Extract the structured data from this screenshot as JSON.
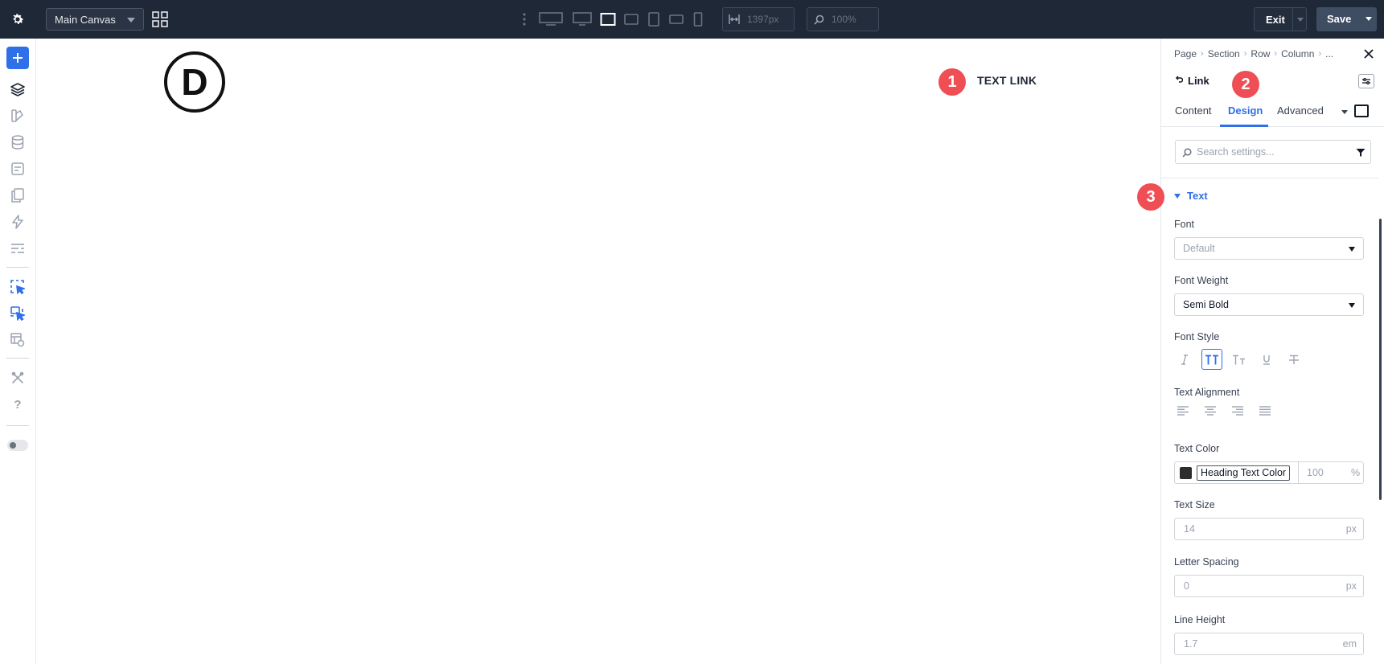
{
  "topbar": {
    "canvas_select": "Main Canvas",
    "width_value": "1397px",
    "zoom_value": "100%",
    "exit_label": "Exit",
    "save_label": "Save",
    "devices": [
      "desktop-wide",
      "desktop",
      "laptop",
      "tablet-landscape",
      "tablet",
      "phone-landscape",
      "phone"
    ],
    "active_device": "laptop"
  },
  "canvas": {
    "logo_letter": "D",
    "text_link": "TEXT LINK"
  },
  "badges": [
    "1",
    "2",
    "3"
  ],
  "panel": {
    "breadcrumbs": [
      "Page",
      "Section",
      "Row",
      "Column",
      "..."
    ],
    "module_name": "Link",
    "tabs": [
      "Content",
      "Design",
      "Advanced"
    ],
    "active_tab": "Design",
    "search_placeholder": "Search settings...",
    "group_title": "Text",
    "font": {
      "label": "Font",
      "value": "Default"
    },
    "font_weight": {
      "label": "Font Weight",
      "value": "Semi Bold"
    },
    "font_style": {
      "label": "Font Style",
      "active": "uppercase"
    },
    "text_alignment": {
      "label": "Text Alignment"
    },
    "text_color": {
      "label": "Text Color",
      "value": "Heading Text Color",
      "opacity": "100",
      "opacity_unit": "%"
    },
    "text_size": {
      "label": "Text Size",
      "value": "14",
      "unit": "px"
    },
    "letter_spacing": {
      "label": "Letter Spacing",
      "value": "0",
      "unit": "px"
    },
    "line_height": {
      "label": "Line Height",
      "value": "1.7",
      "unit": "em"
    }
  },
  "colors": {
    "topbar_bg": "#1f2837",
    "accent": "#2f6fe8",
    "badge": "#ee4e54"
  }
}
